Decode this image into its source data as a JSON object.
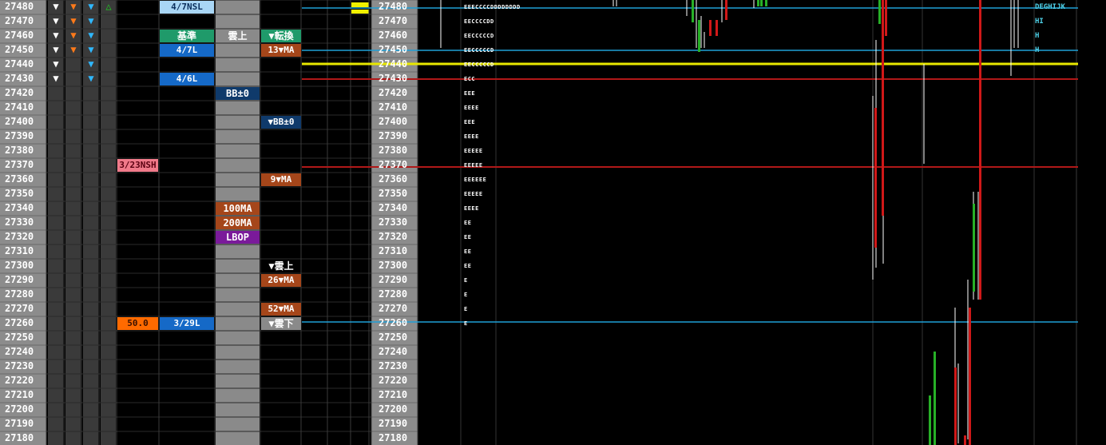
{
  "prices": [
    "27480",
    "27470",
    "27460",
    "27450",
    "27440",
    "27430",
    "27420",
    "27410",
    "27400",
    "27390",
    "27380",
    "27370",
    "27360",
    "27350",
    "27340",
    "27330",
    "27320",
    "27310",
    "27300",
    "27290",
    "27280",
    "27270",
    "27260",
    "27250",
    "27240",
    "27230",
    "27220",
    "27210",
    "27200",
    "27190",
    "27180"
  ],
  "arrow_cols": [
    {
      "row": 0,
      "col": 0,
      "kind": "down",
      "color": "#ffffff"
    },
    {
      "row": 0,
      "col": 1,
      "kind": "down",
      "color": "#ff7a1a"
    },
    {
      "row": 0,
      "col": 2,
      "kind": "down",
      "color": "#2fb8ff"
    },
    {
      "row": 0,
      "col": 3,
      "kind": "up-outline",
      "color": "#1fd11f"
    },
    {
      "row": 1,
      "col": 0,
      "kind": "down",
      "color": "#ffffff"
    },
    {
      "row": 1,
      "col": 1,
      "kind": "down",
      "color": "#ff7a1a"
    },
    {
      "row": 1,
      "col": 2,
      "kind": "down",
      "color": "#2fb8ff"
    },
    {
      "row": 2,
      "col": 0,
      "kind": "down",
      "color": "#ffffff"
    },
    {
      "row": 2,
      "col": 1,
      "kind": "down",
      "color": "#ff7a1a"
    },
    {
      "row": 2,
      "col": 2,
      "kind": "down",
      "color": "#2fb8ff"
    },
    {
      "row": 3,
      "col": 0,
      "kind": "down",
      "color": "#ffffff"
    },
    {
      "row": 3,
      "col": 1,
      "kind": "down",
      "color": "#ff7a1a"
    },
    {
      "row": 3,
      "col": 2,
      "kind": "down",
      "color": "#2fb8ff"
    },
    {
      "row": 4,
      "col": 0,
      "kind": "down",
      "color": "#ffffff"
    },
    {
      "row": 4,
      "col": 2,
      "kind": "down",
      "color": "#2fb8ff"
    },
    {
      "row": 5,
      "col": 0,
      "kind": "down",
      "color": "#ffffff"
    },
    {
      "row": 5,
      "col": 2,
      "kind": "down",
      "color": "#2fb8ff"
    }
  ],
  "labels": {
    "nsl_47": "4/7NSL",
    "kijun": "基準",
    "kumo_up": "雲上",
    "tenkan_down": "▼転換",
    "l_47": "4/7L",
    "ma13": "13▼MA",
    "l_46": "4/6L",
    "bb0": "BB±0",
    "bb0_down": "▼BB±0",
    "nsh_323": "3/23NSH",
    "ma9": "9▼MA",
    "ma100": "100MA",
    "ma200": "200MA",
    "lbop": "LBOP",
    "kumo_up_down": "▼雲上",
    "ma26": "26▼MA",
    "ma52": "52▼MA",
    "val50": "50.0",
    "l_329": "3/29L",
    "kumo_down": "▼雲下"
  },
  "profile": [
    "EEECCCCDDDDDDDD",
    "EECCCCDD",
    "EECCCCCD",
    "EECCCCCD",
    "EECCCCCD",
    "ECC",
    "EEE",
    "EEEE",
    "EEE",
    "EEEE",
    "EEEEE",
    "EEEEE",
    "EEEEEE",
    "EEEEE",
    "EEEE",
    "EE",
    "EE",
    "EE",
    "EE",
    "E",
    "E",
    "E",
    "E"
  ],
  "right_labels": [
    "DEGHIJK",
    "HI",
    "H",
    "H"
  ],
  "colors": {
    "blue_line": "#1f9fd6",
    "yellow_line": "#e8e800",
    "red_line": "#b01818",
    "green_candle": "#27b027",
    "red_candle": "#d01818"
  }
}
